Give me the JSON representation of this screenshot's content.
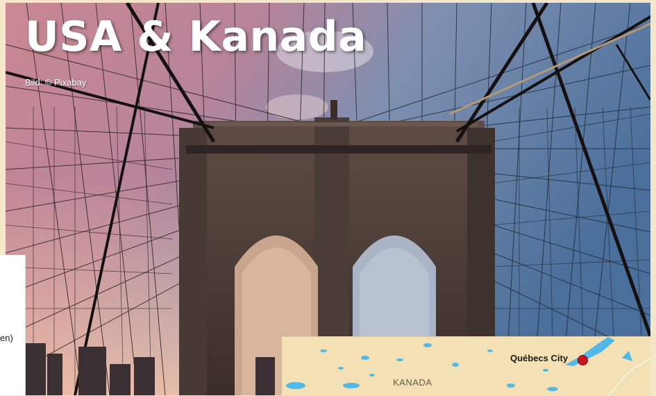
{
  "hero": {
    "title": "USA & Kanada",
    "credit": "Bild: © Pixabay",
    "image_subject": "bridge-photo"
  },
  "left_panel": {
    "text": "en)"
  },
  "map": {
    "country_label": "KANADA",
    "city_label": "Québecs City",
    "marker_color": "#c8141e",
    "water_color": "#52b9e6",
    "land_color": "#f3e1b5"
  }
}
